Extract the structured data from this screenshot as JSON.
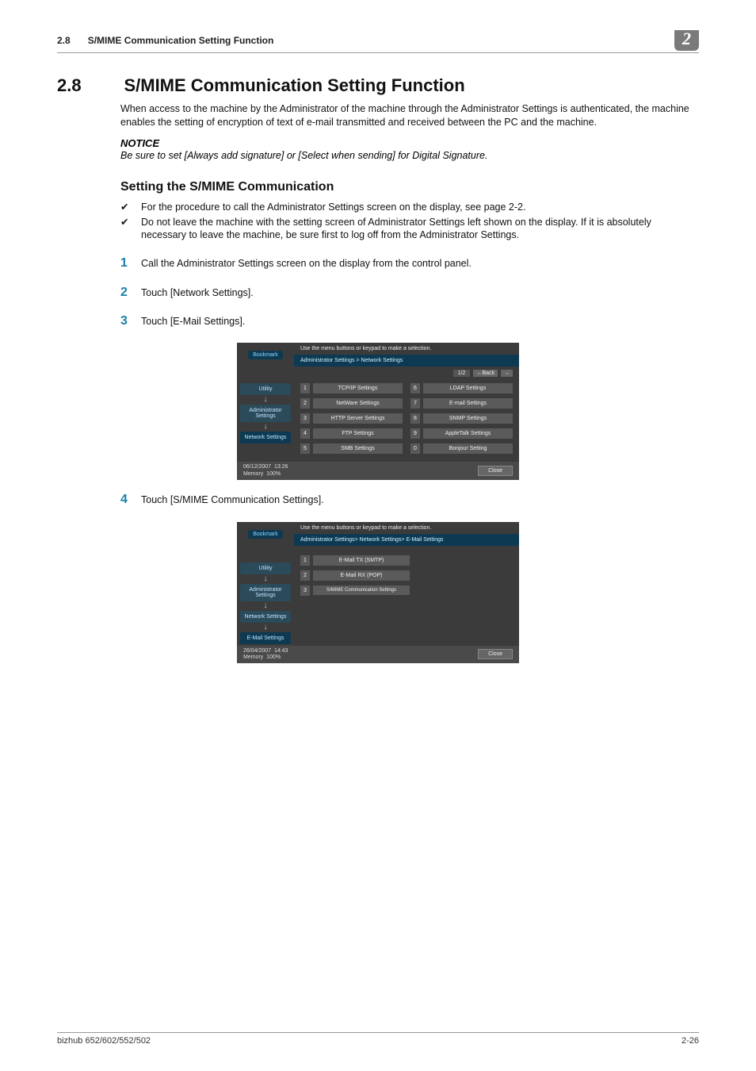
{
  "header": {
    "num": "2.8",
    "title": "S/MIME Communication Setting Function",
    "badge": "2"
  },
  "section": {
    "num": "2.8",
    "title": "S/MIME Communication Setting Function"
  },
  "intro": "When access to the machine by the Administrator of the machine through the Administrator Settings is authenticated, the machine enables the setting of encryption of text of e-mail transmitted and received between the PC and the machine.",
  "notice": {
    "label": "NOTICE",
    "text": "Be sure to set [Always add signature] or [Select when sending] for Digital Signature."
  },
  "h3": "Setting the S/MIME Communication",
  "checks": [
    "For the procedure to call the Administrator Settings screen on the display, see page 2-2.",
    "Do not leave the machine with the setting screen of Administrator Settings left shown on the display. If it is absolutely necessary to leave the machine, be sure first to log off from the Administrator Settings."
  ],
  "steps": [
    "Call the Administrator Settings screen on the display from the control panel.",
    "Touch [Network Settings].",
    "Touch [E-Mail Settings].",
    "Touch [S/MIME Communication Settings]."
  ],
  "step_nums": [
    "1",
    "2",
    "3",
    "4"
  ],
  "check_mark": "✔",
  "ui1": {
    "instruction": "Use the menu buttons or keypad to make a selection.",
    "bookmark": "Bookmark",
    "breadcrumb": "Administrator Settings > Network Settings",
    "page": "1/2",
    "back": "←Back",
    "fwd": "→",
    "sidebar": [
      "Utility",
      "Administrator Settings",
      "Network Settings"
    ],
    "items_left": [
      "TCP/IP Settings",
      "NetWare Settings",
      "HTTP Server Settings",
      "FTP Settings",
      "SMB Settings"
    ],
    "items_left_num": [
      "1",
      "2",
      "3",
      "4",
      "5"
    ],
    "items_right": [
      "LDAP Settings",
      "E-mail Settings",
      "SNMP Settings",
      "AppleTalk Settings",
      "Bonjour Setting"
    ],
    "items_right_num": [
      "6",
      "7",
      "8",
      "9",
      "0"
    ],
    "footer_date": "06/12/2007",
    "footer_time": "13:26",
    "footer_mem_label": "Memory",
    "footer_mem": "100%",
    "close": "Close"
  },
  "ui2": {
    "instruction": "Use the menu buttons or keypad to make a selection.",
    "bookmark": "Bookmark",
    "breadcrumb": "Administrator Settings> Network Settings> E-Mail Settings",
    "sidebar": [
      "Utility",
      "Administrator Settings",
      "Network Settings",
      "E-Mail Settings"
    ],
    "items": [
      "E-Mail TX (SMTP)",
      "E-Mail RX (POP)",
      "S/MIME Communication Settings"
    ],
    "items_num": [
      "1",
      "2",
      "3"
    ],
    "footer_date": "26/04/2007",
    "footer_time": "14:43",
    "footer_mem_label": "Memory",
    "footer_mem": "100%",
    "close": "Close"
  },
  "footer": {
    "left": "bizhub 652/602/552/502",
    "right": "2-26"
  }
}
